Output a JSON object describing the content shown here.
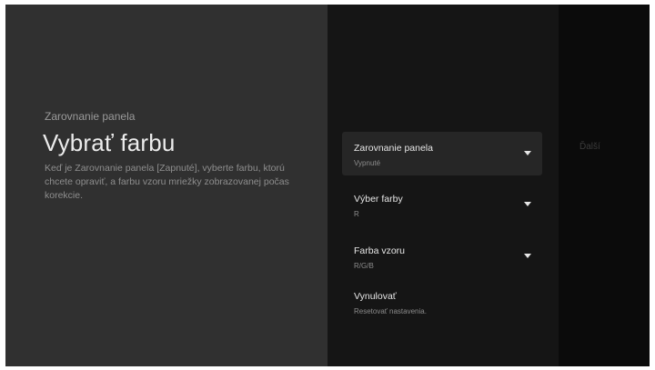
{
  "left_panel": {
    "breadcrumb": "Zarovnanie panela",
    "title": "Vybrať farbu",
    "description": "Keď je Zarovnanie panela [Zapnuté], vyberte farbu, ktorú chcete opraviť, a farbu vzoru mriežky zobrazovanej počas korekcie."
  },
  "settings": {
    "items": [
      {
        "label": "Zarovnanie panela",
        "value": "Vypnuté",
        "icon": "dropdown-caret-icon"
      },
      {
        "label": "Výber farby",
        "value": "R",
        "icon": "dropdown-caret-icon"
      },
      {
        "label": "Farba vzoru",
        "value": "R/G/B",
        "icon": "dropdown-caret-icon"
      },
      {
        "label": "Vynulovať",
        "value": "Resetovať nastavenia."
      }
    ]
  },
  "right_panel": {
    "next_label": "Ďalší"
  },
  "colors": {
    "left_panel_bg": "#303030",
    "middle_panel_bg": "#151515",
    "right_panel_bg": "#0b0b0b",
    "focused_item_bg": "#262626",
    "primary_text": "#e6e6e6",
    "secondary_text": "#8c8c8c"
  }
}
